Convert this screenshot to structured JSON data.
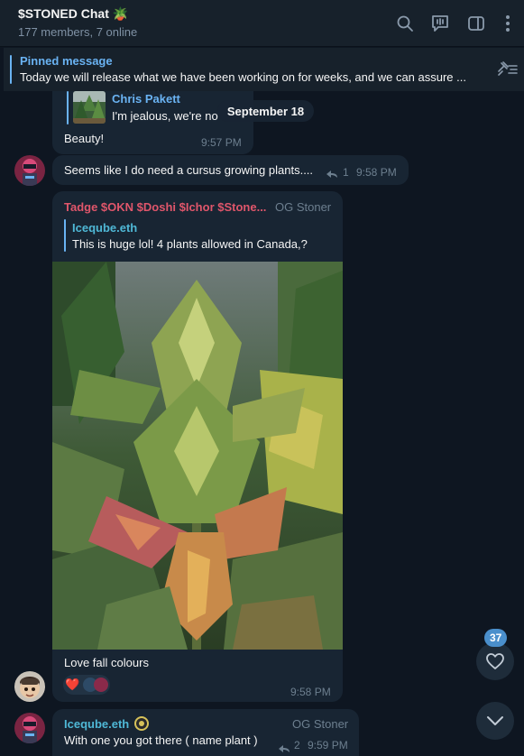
{
  "header": {
    "title": "$STONED Chat 🪴",
    "subtitle": "177 members, 7 online",
    "icons": [
      "search-icon",
      "live-chat-icon",
      "sidebar-toggle-icon",
      "more-vertical-icon"
    ]
  },
  "pinned": {
    "label": "Pinned message",
    "text": "Today we will release what we have been working on for weeks, and we can assure ...",
    "icon": "unpin-list-icon"
  },
  "date_divider": "September 18",
  "messages": [
    {
      "reply": {
        "name": "Chris Pakett",
        "text": "I'm jealous, we're not"
      },
      "text": "Beauty!",
      "time": "9:57 PM"
    },
    {
      "text": "Seems like I do need a cursus growing plants....",
      "replies": "1",
      "time": "9:58 PM"
    },
    {
      "sender": "Tadge $OKN $Doshi $Ichor $Stone...",
      "rank": "OG Stoner",
      "reply": {
        "name": "Iceqube.eth",
        "text": "This is huge lol! 4 plants allowed in Canada,?"
      },
      "photo": "cannabis-plant-photo",
      "text": "Love fall colours",
      "time": "9:58 PM",
      "reactions": [
        "❤️"
      ]
    },
    {
      "sender": "Iceqube.eth",
      "rank": "OG Stoner",
      "text": "With one you got there ( name plant )",
      "replies": "2",
      "time": "9:59 PM"
    }
  ],
  "buttons": {
    "reactions_badge": "37",
    "reactions_icon": "heart-icon",
    "scroll_icon": "chevron-down-icon"
  },
  "colors": {
    "background": "#0e1621",
    "panel": "#17212b",
    "bubble": "#182533",
    "accent": "#6ab3f3",
    "sender_red": "#e0566b",
    "meta": "#6d7f8f"
  }
}
